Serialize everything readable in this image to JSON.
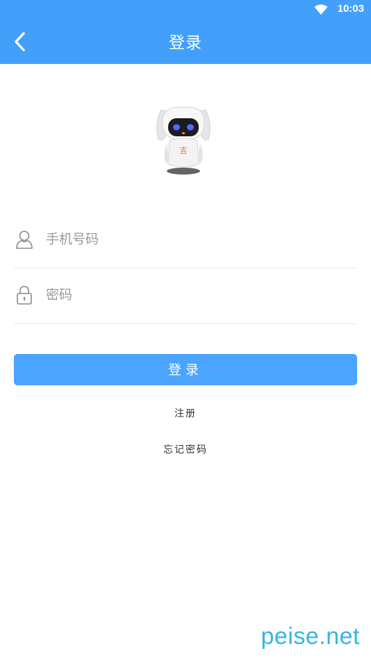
{
  "status_bar": {
    "time": "10:03",
    "wifi_icon": "wifi-icon"
  },
  "app_bar": {
    "back_icon": "chevron-left-icon",
    "title": "登录",
    "background_color": "#42a0fb"
  },
  "mascot": {
    "icon": "robot-mascot-icon",
    "badge_text": "吉"
  },
  "form": {
    "phone": {
      "icon": "user-icon",
      "placeholder": "手机号码",
      "value": ""
    },
    "password": {
      "icon": "lock-icon",
      "placeholder": "密码",
      "value": ""
    }
  },
  "actions": {
    "login_label": "登录",
    "login_color": "#4ba4fd",
    "register_label": "注册",
    "forgot_label": "忘记密码"
  },
  "watermark": {
    "text": "peise.net",
    "color": "#35b6e6"
  }
}
